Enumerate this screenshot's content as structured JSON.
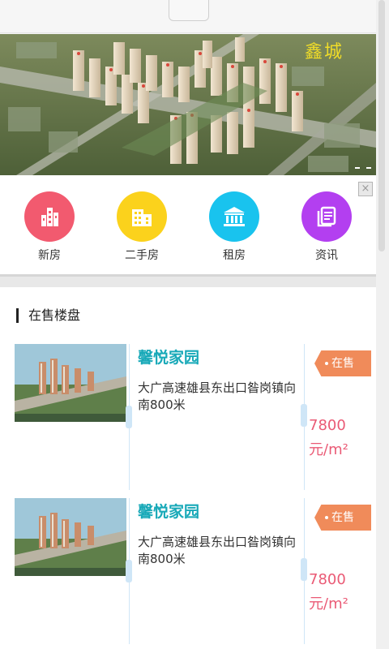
{
  "banner": {
    "overlay_text": "鑫城"
  },
  "menu": {
    "close_label": "×",
    "items": [
      {
        "label": "新房",
        "icon": "building-icon",
        "color": "#f25a6f"
      },
      {
        "label": "二手房",
        "icon": "apartment-icon",
        "color": "#fbd21c"
      },
      {
        "label": "租房",
        "icon": "bank-icon",
        "color": "#19c3ee"
      },
      {
        "label": "资讯",
        "icon": "news-icon",
        "color": "#b33ff0"
      }
    ]
  },
  "section": {
    "title": "在售楼盘"
  },
  "listings": [
    {
      "name": "馨悦家园",
      "address": "大广高速雄县东出口昝岗镇向南800米",
      "status": "在售",
      "price": "7800",
      "unit": "元/m²"
    },
    {
      "name": "馨悦家园",
      "address": "大广高速雄县东出口昝岗镇向南800米",
      "status": "在售",
      "price": "7800",
      "unit": "元/m²"
    }
  ]
}
